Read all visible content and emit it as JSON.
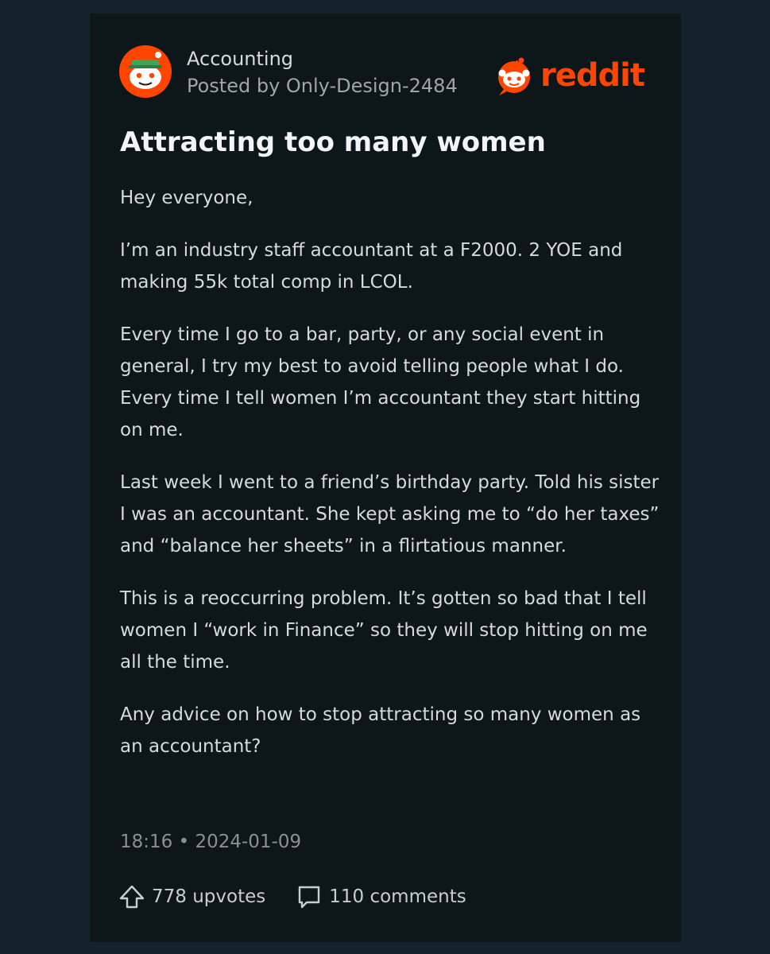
{
  "post": {
    "subreddit": "Accounting",
    "posted_by": "Posted by Only-Design-2484",
    "brand": "reddit",
    "title": "Attracting too many women",
    "paragraphs": [
      "Hey everyone,",
      "I’m an industry staff accountant at a F2000. 2 YOE and making 55k total comp in LCOL.",
      "Every time I go to a bar, party, or any social event in general, I try my best to avoid telling people what I do. Every time I tell women I’m accountant they start hitting on me.",
      "Last week I went to a friend’s birthday party. Told his sister I was an accountant. She kept asking me to “do her taxes” and “balance her sheets” in a flirtatious manner.",
      "This is a reoccurring problem. It’s gotten so bad that I tell women I “work in Finance” so they will stop hitting on me all the time.",
      "Any advice on how to stop attracting so many women as an accountant?"
    ],
    "timestamp": "18:16 • 2024-01-09",
    "upvotes": "778 upvotes",
    "comments": "110 comments"
  },
  "icons": {
    "avatar": "subreddit-avatar-snoo",
    "brand": "reddit-snoo-logo",
    "upvote": "upvote-arrow-icon",
    "comment": "comment-bubble-icon"
  },
  "colors": {
    "background": "#14232a",
    "card": "#0d1619",
    "brand": "#ff4500",
    "text": "#d7dadc",
    "muted": "#8a9094"
  }
}
